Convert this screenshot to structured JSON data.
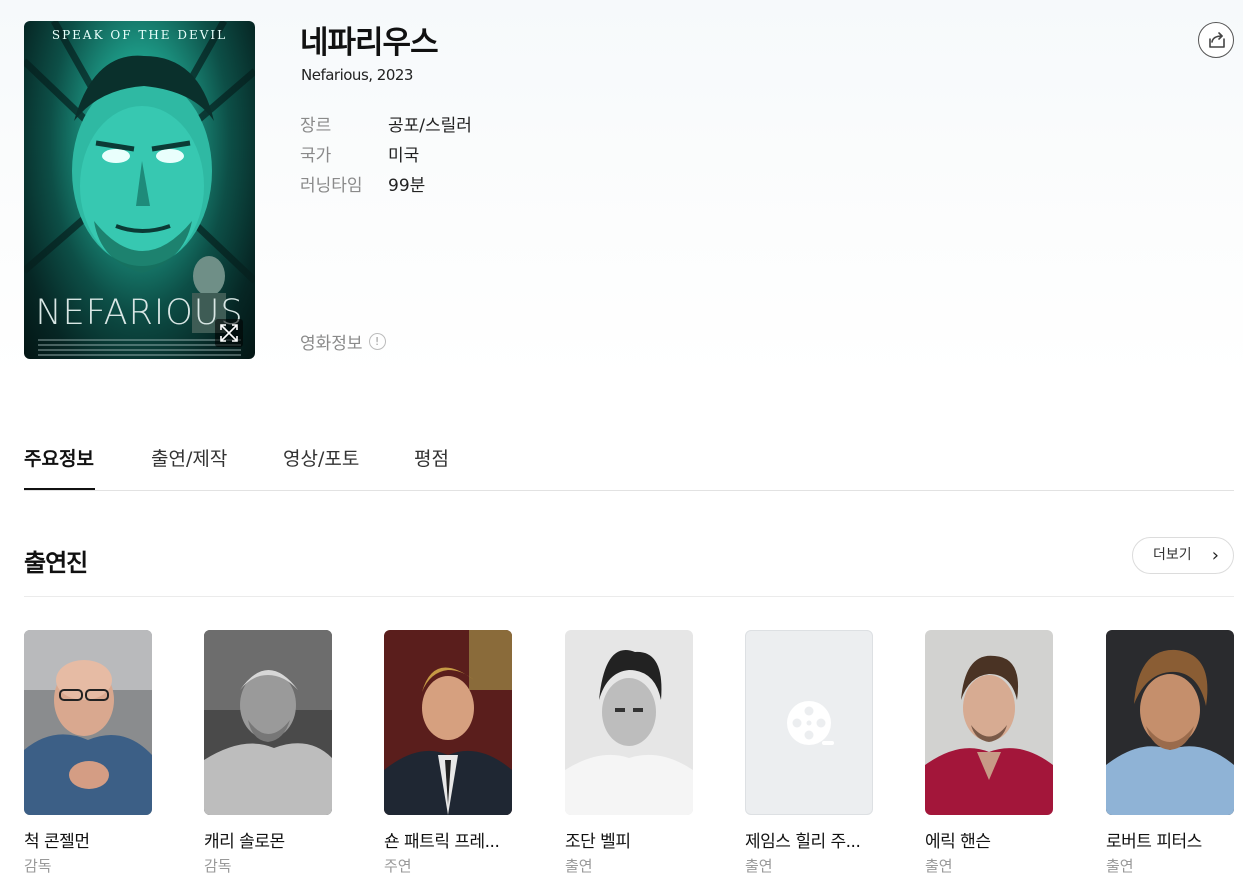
{
  "movie": {
    "title": "네파리우스",
    "subtitle": "Nefarious, 2023",
    "poster": {
      "tagline": "SPEAK OF THE DEVIL",
      "title_text": "NEFARIOUS"
    },
    "details": [
      {
        "label": "장르",
        "value": "공포/스릴러"
      },
      {
        "label": "국가",
        "value": "미국"
      },
      {
        "label": "러닝타임",
        "value": "99분"
      }
    ],
    "movie_info_label": "영화정보",
    "info_badge": "!"
  },
  "tabs": [
    {
      "label": "주요정보",
      "active": true
    },
    {
      "label": "출연/제작",
      "active": false
    },
    {
      "label": "영상/포토",
      "active": false
    },
    {
      "label": "평점",
      "active": false
    }
  ],
  "cast_section": {
    "title": "출연진",
    "more_label": "더보기",
    "members": [
      {
        "name": "척 콘젤먼",
        "role": "감독",
        "photo": "person-photo"
      },
      {
        "name": "캐리 솔로몬",
        "role": "감독",
        "photo": "person-photo"
      },
      {
        "name": "숀 패트릭 프레...",
        "role": "주연",
        "photo": "person-photo"
      },
      {
        "name": "조단 벨피",
        "role": "출연",
        "photo": "person-photo"
      },
      {
        "name": "제임스 힐리 주...",
        "role": "출연",
        "photo": "film-reel-placeholder-icon"
      },
      {
        "name": "에릭 핸슨",
        "role": "출연",
        "photo": "person-photo"
      },
      {
        "name": "로버트 피터스",
        "role": "출연",
        "photo": "person-photo"
      }
    ]
  },
  "icons": {
    "share": "share-icon",
    "expand": "expand-icon",
    "chevron": "chevron-right-icon"
  },
  "colors": {
    "poster_teal": "#1e9e8a",
    "tab_active": "#111111",
    "muted_text": "#8a8a8a"
  }
}
